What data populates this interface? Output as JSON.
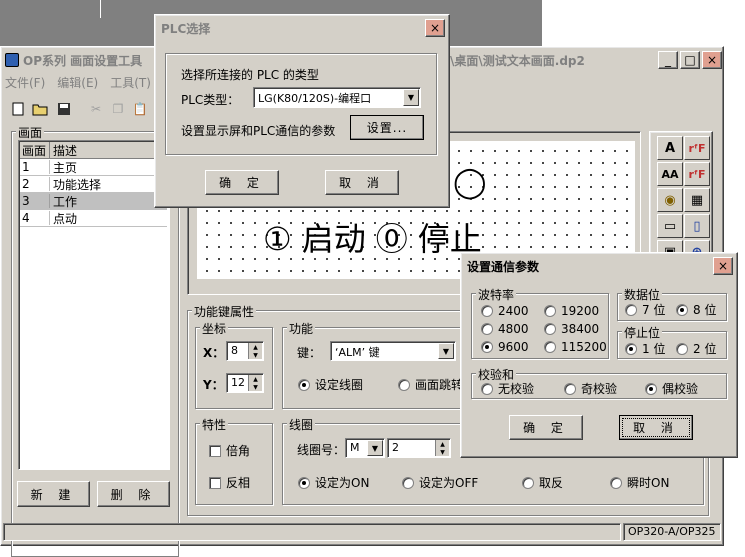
{
  "desktop": {
    "bg_color": "#808080"
  },
  "main_window": {
    "title": "OP系列 画面设置工具",
    "title_path": "\\桌面\\测试文本画面.dp2",
    "min_label": "_",
    "max_label": "□",
    "close_label": "×",
    "menu": [
      "文件(F)",
      "编辑(E)",
      "工具(T)"
    ],
    "status_model": "OP320-A/OP325"
  },
  "toolbar": {
    "icons": [
      "new-file-icon",
      "open-folder-icon",
      "save-icon",
      "cut-icon",
      "copy-icon",
      "paste-icon"
    ]
  },
  "screen_panel": {
    "group_label": "画面",
    "headers": [
      "画面",
      "描述"
    ],
    "rows": [
      {
        "id": "1",
        "desc": "主页"
      },
      {
        "id": "2",
        "desc": "功能选择"
      },
      {
        "id": "3",
        "desc": "工作"
      },
      {
        "id": "4",
        "desc": "点动"
      }
    ],
    "selected_row": 2,
    "new_button": "新 建",
    "delete_button": "删 除"
  },
  "canvas": {
    "line1_prefix": "①",
    "line1_text": "启动",
    "line1_prefix2": "⓪",
    "line1_text2": "停止",
    "top_symbol": "◯"
  },
  "right_toolbar": {
    "items": [
      "A",
      "rᶠF",
      "AA",
      "rᶠF",
      "◉",
      "▦",
      "▭",
      "▯",
      "▣",
      "⊕"
    ]
  },
  "key_props": {
    "group_label": "功能键属性",
    "coord_label": "坐标",
    "x_label": "X：",
    "x_value": "8",
    "y_label": "Y：",
    "y_value": "12",
    "func_label": "功能",
    "key_label": "键：",
    "key_value": "‘ALM’ 键",
    "set_coil": "设定线圈",
    "screen_jump": "画面跳转",
    "special_label": "特性",
    "double_angle": "倍角",
    "invert": "反相",
    "coil_label": "线圈",
    "coil_no_label": "线圈号：",
    "coil_type": "M",
    "coil_no": "2",
    "set_on": "设定为ON",
    "set_off": "设定为OFF",
    "toggle": "取反",
    "momentary": "瞬时ON"
  },
  "plc_dialog": {
    "title": "PLC选择",
    "prompt": "选择所连接的 PLC 的类型",
    "type_label": "PLC类型：",
    "type_value": "LG(K80/120S)-编程口",
    "comm_prompt": "设置显示屏和PLC通信的参数",
    "settings_button": "设置...",
    "ok_button": "确 定",
    "cancel_button": "取 消"
  },
  "comm_dialog": {
    "title": "设置通信参数",
    "baud_label": "波特率",
    "bauds": [
      "2400",
      "19200",
      "4800",
      "38400",
      "9600",
      "115200"
    ],
    "baud_selected": "9600",
    "databits_label": "数据位",
    "databits": [
      "7 位",
      "8 位"
    ],
    "databits_selected": "8 位",
    "stopbits_label": "停止位",
    "stopbits": [
      "1 位",
      "2 位"
    ],
    "stopbits_selected": "1 位",
    "parity_label": "校验和",
    "parity": [
      "无校验",
      "奇校验",
      "偶校验"
    ],
    "parity_selected": "偶校验",
    "ok_button": "确 定",
    "cancel_button": "取 消"
  }
}
